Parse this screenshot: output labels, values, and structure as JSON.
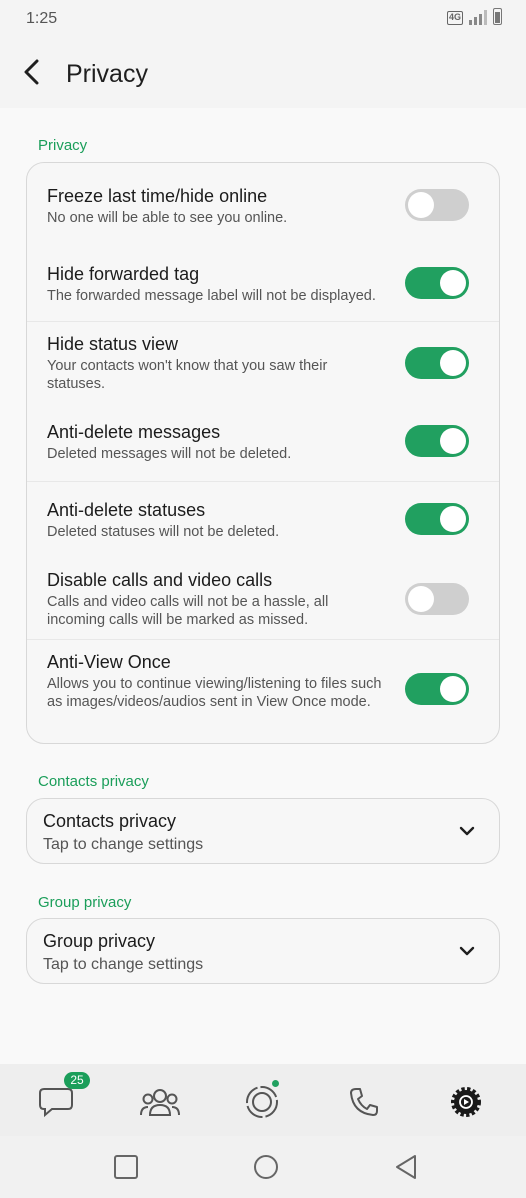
{
  "status_bar": {
    "time": "1:25",
    "network": "4G"
  },
  "header": {
    "title": "Privacy"
  },
  "sections": {
    "privacy_label": "Privacy",
    "contacts_label": "Contacts privacy",
    "group_label": "Group privacy"
  },
  "privacy_items": [
    {
      "title": "Freeze last time/hide online",
      "desc": "No one will be able to see you online.",
      "enabled": false
    },
    {
      "title": "Hide forwarded tag",
      "desc": "The forwarded message label will not be displayed.",
      "enabled": true
    },
    {
      "title": "Hide status view",
      "desc": "Your contacts won't know that you saw their statuses.",
      "enabled": true
    },
    {
      "title": "Anti-delete messages",
      "desc": "Deleted messages will not be deleted.",
      "enabled": true
    },
    {
      "title": "Anti-delete statuses",
      "desc": "Deleted statuses will not be deleted.",
      "enabled": true
    },
    {
      "title": "Disable calls and video calls",
      "desc": "Calls and video calls will not be a hassle, all incoming calls will be marked as missed.",
      "enabled": false
    },
    {
      "title": "Anti-View Once",
      "desc": "Allows you to continue viewing/listening to files such as images/videos/audios sent in View Once mode.",
      "enabled": true
    }
  ],
  "contacts_privacy": {
    "title": "Contacts privacy",
    "subtitle": "Tap to change settings"
  },
  "group_privacy": {
    "title": "Group privacy",
    "subtitle": "Tap to change settings"
  },
  "bottom_nav": {
    "chats_badge": "25",
    "items": [
      "chats-icon",
      "community-icon",
      "status-icon",
      "calls-icon",
      "settings-icon"
    ]
  },
  "colors": {
    "accent": "#1b9e5a",
    "toggle_on": "#21a060",
    "toggle_off": "#cfcfcf"
  }
}
